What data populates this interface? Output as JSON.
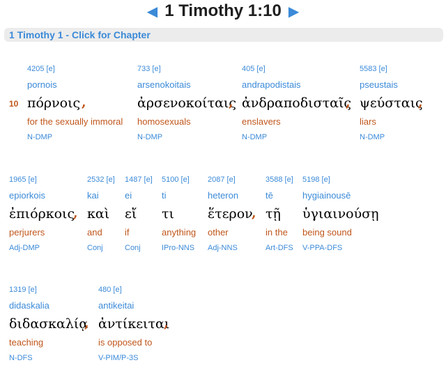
{
  "header": {
    "title": "1 Timothy 1:10",
    "prev_arrow": "◀",
    "next_arrow": "▶"
  },
  "chapter_bar": {
    "label": "1 Timothy 1 - Click for Chapter"
  },
  "verse": {
    "number": "10"
  },
  "words": [
    {
      "strongs": "4205 [e]",
      "translit": "pornois",
      "greek": "πόρνοις",
      "english": "for the sexually immoral",
      "parsing": "N-DMP",
      "punct": ","
    },
    {
      "strongs": "733 [e]",
      "translit": "arsenokoitais",
      "greek": "ἀρσενοκοίταις",
      "english": "homosexuals",
      "parsing": "N-DMP",
      "punct": ","
    },
    {
      "strongs": "405 [e]",
      "translit": "andrapodistais",
      "greek": "ἀνδραποδισταῖς",
      "english": "enslavers",
      "parsing": "N-DMP",
      "punct": ","
    },
    {
      "strongs": "5583 [e]",
      "translit": "pseustais",
      "greek": "ψεύσταις",
      "english": "liars",
      "parsing": "N-DMP",
      "punct": ","
    },
    {
      "strongs": "1965 [e]",
      "translit": "epiorkois",
      "greek": "ἐπιόρκοις",
      "english": "perjurers",
      "parsing": "Adj-DMP",
      "punct": ","
    },
    {
      "strongs": "2532 [e]",
      "translit": "kai",
      "greek": "καὶ",
      "english": "and",
      "parsing": "Conj",
      "punct": ""
    },
    {
      "strongs": "1487 [e]",
      "translit": "ei",
      "greek": "εἴ",
      "english": "if",
      "parsing": "Conj",
      "punct": ""
    },
    {
      "strongs": "5100 [e]",
      "translit": "ti",
      "greek": "τι",
      "english": "anything",
      "parsing": "IPro-NNS",
      "punct": ""
    },
    {
      "strongs": "2087 [e]",
      "translit": "heteron",
      "greek": "ἕτερον",
      "english": "other",
      "parsing": "Adj-NNS",
      "punct": ","
    },
    {
      "strongs": "3588 [e]",
      "translit": "tē",
      "greek": "τῇ",
      "english": "in the",
      "parsing": "Art-DFS",
      "punct": ""
    },
    {
      "strongs": "5198 [e]",
      "translit": "hygiainousē",
      "greek": "ὑγιαινούσῃ",
      "english": "being sound",
      "parsing": "V-PPA-DFS",
      "punct": ""
    },
    {
      "strongs": "1319 [e]",
      "translit": "didaskalia",
      "greek": "διδασκαλίᾳ",
      "english": "teaching",
      "parsing": "N-DFS",
      "punct": ","
    },
    {
      "strongs": "480 [e]",
      "translit": "antikeitai",
      "greek": "ἀντίκειται",
      "english": "is opposed to",
      "parsing": "V-PIM/P-3S",
      "punct": ","
    }
  ]
}
